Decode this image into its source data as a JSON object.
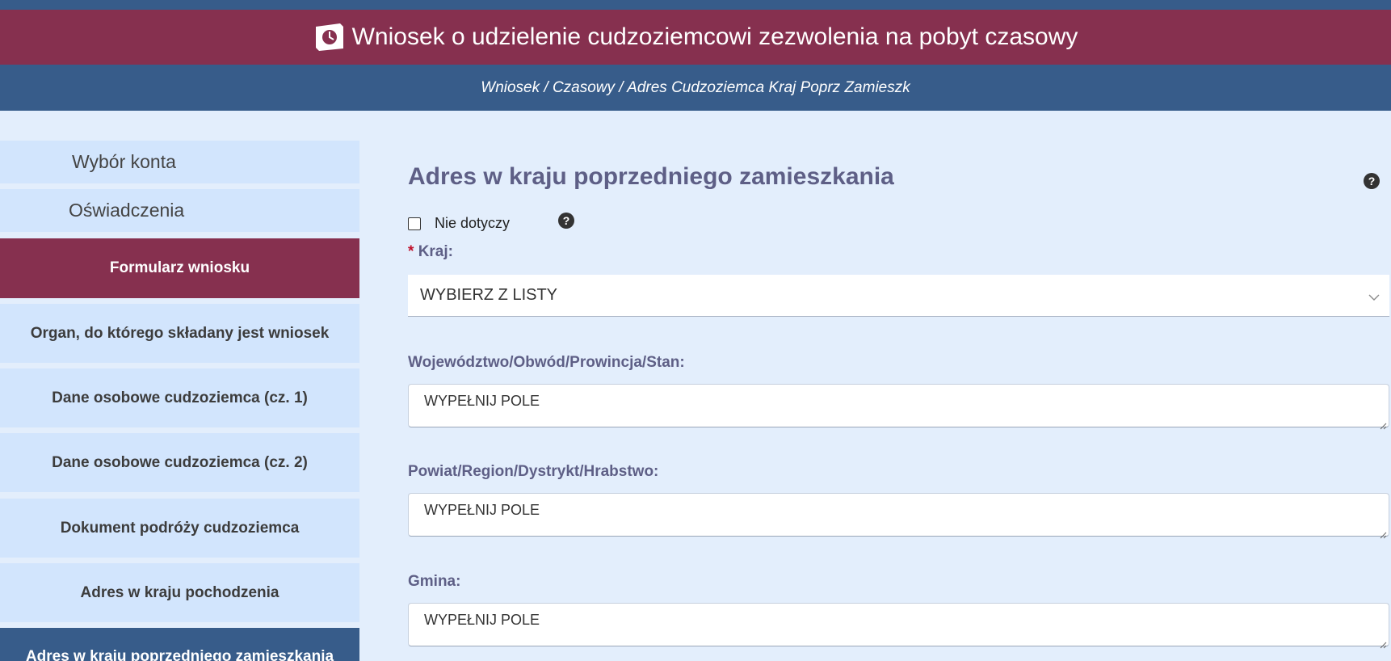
{
  "header": {
    "title": "Wniosek o udzielenie cudzoziemcowi zezwolenia na pobyt czasowy",
    "icon": "clock-document-icon",
    "background": "#86304f"
  },
  "breadcrumb": {
    "text": "Wniosek / Czasowy / Adres Cudzoziemca Kraj Poprz Zamieszk"
  },
  "sidebar": {
    "items": [
      {
        "label": "Wybór konta"
      },
      {
        "label": "Oświadczenia"
      },
      {
        "label": "Formularz wniosku"
      },
      {
        "label": "Organ, do którego składany jest wniosek"
      },
      {
        "label": "Dane osobowe cudzoziemca (cz. 1)"
      },
      {
        "label": "Dane osobowe cudzoziemca (cz. 2)"
      },
      {
        "label": "Dokument podróży cudzoziemca"
      },
      {
        "label": "Adres w kraju pochodzenia"
      },
      {
        "label": "Adres w kraju poprzedniego zamieszkania"
      }
    ]
  },
  "main": {
    "title": "Adres w kraju poprzedniego zamieszkania",
    "not_applicable_label": "Nie dotyczy",
    "help_glyph": "?",
    "required_marker": "*",
    "country": {
      "label": "Kraj:",
      "selected": "WYBIERZ Z LISTY"
    },
    "voivodeship": {
      "label": "Województwo/Obwód/Prowincja/Stan:",
      "placeholder": "WYPEŁNIJ POLE"
    },
    "district": {
      "label": "Powiat/Region/Dystrykt/Hrabstwo:",
      "placeholder": "WYPEŁNIJ POLE"
    },
    "commune": {
      "label": "Gmina:",
      "placeholder": "WYPEŁNIJ POLE"
    }
  },
  "colors": {
    "primary_blue": "#375c8a",
    "accent_red": "#86304f",
    "label_color": "#5e5f86",
    "page_bg": "#e3eefc"
  }
}
